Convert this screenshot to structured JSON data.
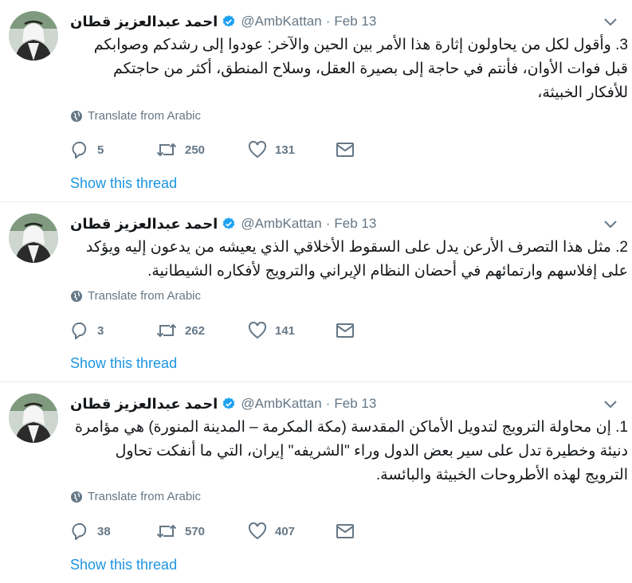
{
  "tweets": [
    {
      "name": "احمد عبدالعزيز قطان",
      "handle": "@AmbKattan",
      "separator": "·",
      "date": "Feb 13",
      "text": "3. وأقول لكل من يحاولون إثارة هذا الأمر بين الحين والآخر: عودوا إلى رشدكم وصوابكم قبل فوات الأوان، فأنتم في حاجة إلى بصيرة العقل، وسلاح المنطق، أكثر من حاجتكم للأفكار الخبيثة،",
      "translate_label": "Translate from Arabic",
      "replies": "5",
      "retweets": "250",
      "likes": "131",
      "show_thread": "Show this thread"
    },
    {
      "name": "احمد عبدالعزيز قطان",
      "handle": "@AmbKattan",
      "separator": "·",
      "date": "Feb 13",
      "text": "2. مثل هذا التصرف الأرعن يدل على السقوط الأخلاقي الذي يعيشه من يدعون إليه ويؤكد على إفلاسهم وارتمائهم في أحضان النظام الإيراني والترويج لأفكاره الشيطانية.",
      "translate_label": "Translate from Arabic",
      "replies": "3",
      "retweets": "262",
      "likes": "141",
      "show_thread": "Show this thread"
    },
    {
      "name": "احمد عبدالعزيز قطان",
      "handle": "@AmbKattan",
      "separator": "·",
      "date": "Feb 13",
      "text": "1. إن محاولة الترويج لتدويل الأماكن المقدسة (مكة المكرمة – المدينة المنورة) هي مؤامرة دنيئة وخطيرة تدل على سير بعض الدول وراء \"الشريفه\" إيران، التي ما أنفكت تحاول الترويج لهذه الأطروحات الخبيثة والبائسة.",
      "translate_label": "Translate from Arabic",
      "replies": "38",
      "retweets": "570",
      "likes": "407",
      "show_thread": "Show this thread"
    }
  ],
  "colors": {
    "link": "#1b95e0",
    "muted": "#657786",
    "text": "#14171a",
    "divider": "#e6ecf0",
    "verified": "#1da1f2"
  },
  "icons": {
    "verified": "verified-badge-icon",
    "caret": "chevron-down-icon",
    "globe": "globe-icon",
    "reply": "reply-icon",
    "retweet": "retweet-icon",
    "like": "heart-icon",
    "dm": "envelope-icon"
  }
}
